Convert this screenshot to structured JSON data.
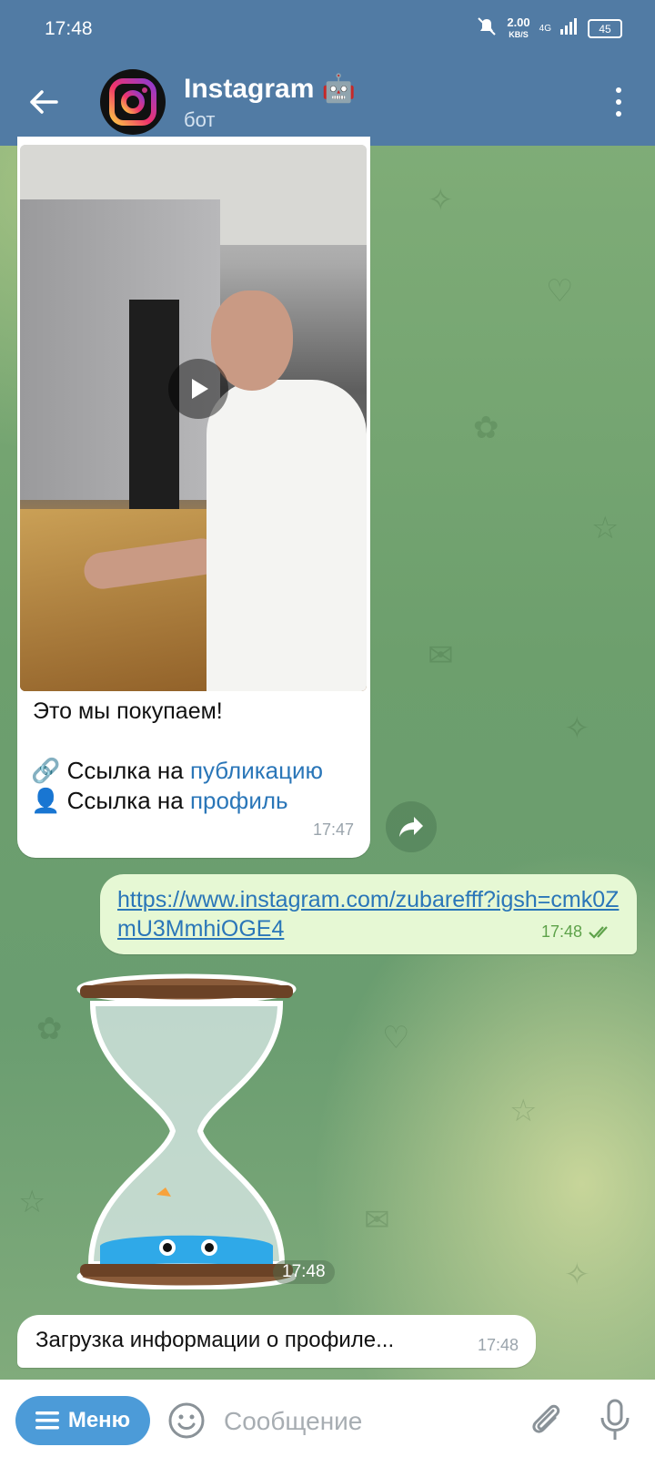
{
  "status_bar": {
    "time": "17:48",
    "speed_value": "2.00",
    "speed_unit": "KB/S",
    "network": "4G",
    "battery": "45"
  },
  "header": {
    "title": "Instagram 🤖",
    "subtitle": "бот"
  },
  "messages": {
    "incoming_media": {
      "caption": "Это мы покупаем!",
      "link1_prefix": "Ссылка на",
      "link1_text": "публикацию",
      "link2_prefix": "Ссылка на",
      "link2_text": "профиль",
      "time": "17:47"
    },
    "outgoing": {
      "url": "https://www.instagram.com/zubarefff?igsh=cmk0ZmU3MmhiOGE4",
      "time": "17:48"
    },
    "sticker": {
      "time": "17:48"
    },
    "loading": {
      "text": "Загрузка информации о профиле...",
      "time": "17:48"
    }
  },
  "input_bar": {
    "menu_label": "Меню",
    "placeholder": "Сообщение"
  },
  "colors": {
    "header": "#517ba4",
    "link": "#2a76b8",
    "outgoing_bubble": "#e6f8d4",
    "menu_button": "#4c9bd8"
  }
}
